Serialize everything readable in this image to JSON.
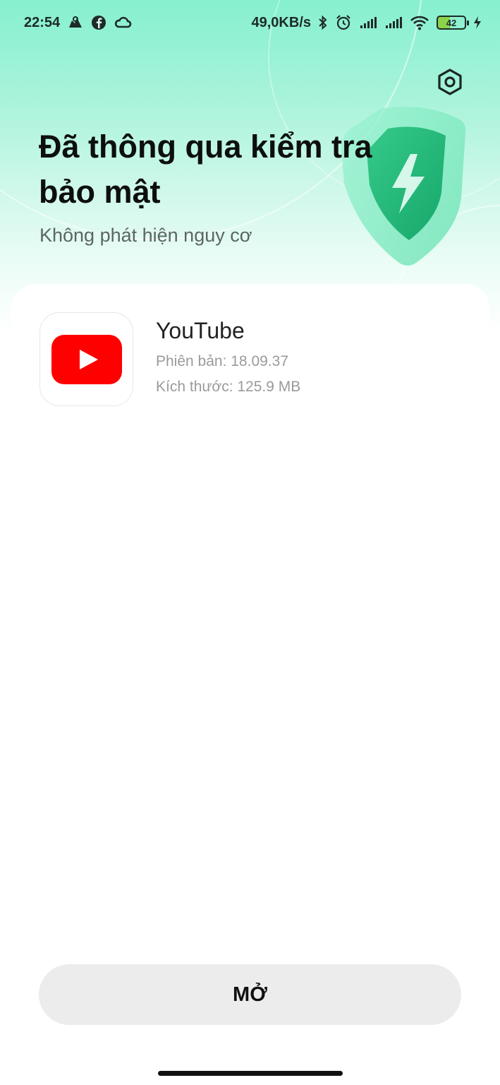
{
  "status_bar": {
    "time": "22:54",
    "network_speed": "49,0KB/s",
    "battery_level": "42",
    "left_icons": [
      "cloud-sync-icon",
      "facebook-icon",
      "cloud-icon"
    ],
    "right_icons": [
      "bluetooth-icon",
      "alarm-icon",
      "signal-icon",
      "signal-icon",
      "wifi-icon",
      "battery-icon",
      "charging-icon"
    ]
  },
  "header": {
    "title": "Đã thông qua kiểm tra bảo mật",
    "subtitle": "Không phát hiện nguy cơ",
    "settings_icon": "settings-hexagon-icon",
    "illustration": "shield-lightning-icon"
  },
  "app": {
    "name": "YouTube",
    "version": "Phiên bản: 18.09.37",
    "size": "Kích thước: 125.9 MB",
    "icon": "youtube-icon"
  },
  "actions": {
    "open_label": "MỞ"
  },
  "colors": {
    "accent_green": "#86f0cf",
    "youtube_red": "#ff0000",
    "button_bg": "#ececec"
  }
}
